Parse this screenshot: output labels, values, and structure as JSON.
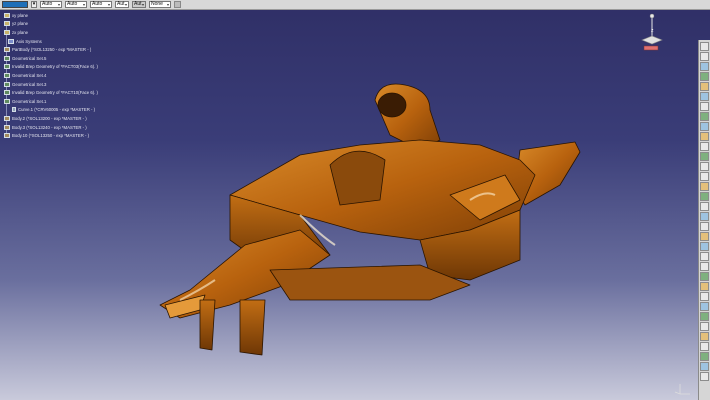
{
  "toolbar": {
    "fill_color": "#1e6fb8",
    "selects": [
      {
        "value": "Auto"
      },
      {
        "value": "Auto"
      },
      {
        "value": "Auto"
      },
      {
        "value": "Aut"
      },
      {
        "value": "Aut"
      },
      {
        "value": "None"
      }
    ]
  },
  "tree": {
    "items": [
      {
        "label": "xy plane",
        "icon": "plane-icon"
      },
      {
        "label": "yz plane",
        "icon": "plane-icon"
      },
      {
        "label": "zx plane",
        "icon": "plane-icon"
      },
      {
        "label": "Axis Systems",
        "icon": "axis-icon"
      },
      {
        "label": "PartBody (*SOL13250 - exp *MASTER - )",
        "icon": "body-icon"
      },
      {
        "label": "Geometrical Set.5",
        "icon": "geometrical-set-icon"
      },
      {
        "label": "Invalid Brep Geometry of *FACT03(Face 6). )",
        "icon": "geometrical-set-icon"
      },
      {
        "label": "Geometrical Set.4",
        "icon": "geometrical-set-icon"
      },
      {
        "label": "Geometrical Set.3",
        "icon": "geometrical-set-icon"
      },
      {
        "label": "Invalid Brep Geometry of *FACT10(Face 6). )",
        "icon": "geometrical-set-icon"
      },
      {
        "label": "Geometrical Set.1",
        "icon": "geometrical-set-icon"
      },
      {
        "label": "Curve.1 (*CRV60005 - exp *MASTER - )",
        "icon": "curve-icon"
      },
      {
        "label": "Body.2 (*SOL13200 - exp *MASTER - )",
        "icon": "body-icon"
      },
      {
        "label": "Body.3 (*SOL13240 - exp *MASTER - )",
        "icon": "body-icon"
      },
      {
        "label": "Body.10 (*SOL13250 - exp *MASTER - )",
        "icon": "body-icon"
      }
    ]
  },
  "viewport": {
    "model": "race-car-body",
    "model_color": "#b8620e",
    "background_top": "#2f2f66",
    "background_bottom": "#c9cadb"
  },
  "vbar_count": 34
}
